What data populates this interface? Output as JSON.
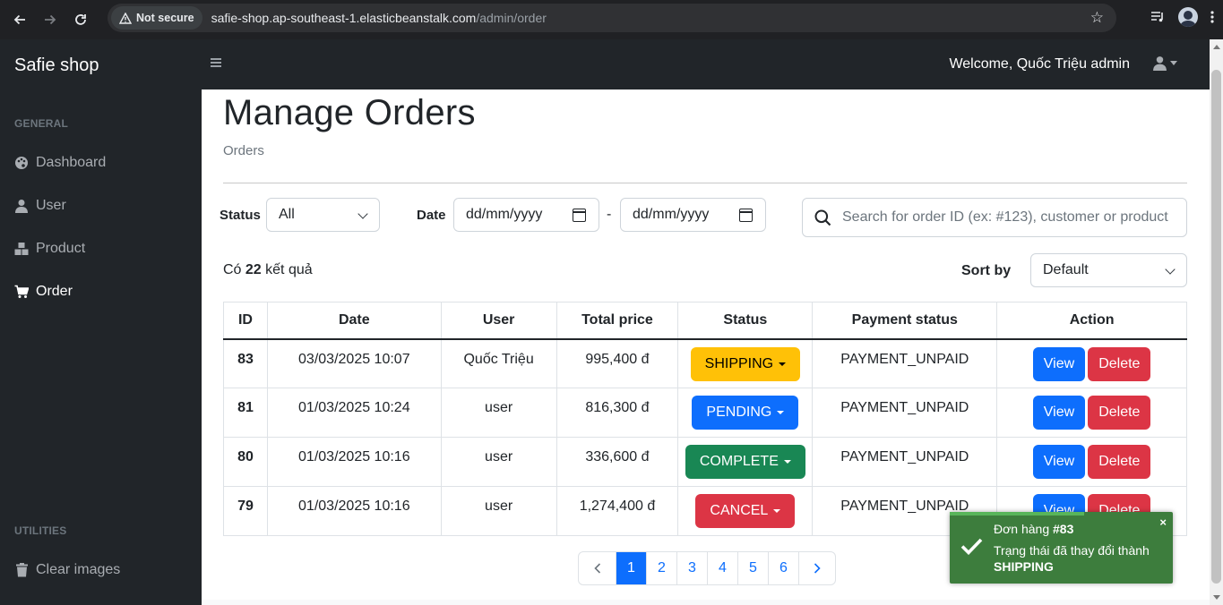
{
  "browser": {
    "security_label": "Not secure",
    "url_host": "safie-shop.ap-southeast-1.elasticbeanstalk.com",
    "url_path": "/admin/order"
  },
  "sidebar": {
    "brand": "Safie shop",
    "general_heading": "GENERAL",
    "utilities_heading": "UTILITIES",
    "items": [
      {
        "label": "Dashboard",
        "icon": "palette-icon"
      },
      {
        "label": "User",
        "icon": "user-icon"
      },
      {
        "label": "Product",
        "icon": "boxes-icon"
      },
      {
        "label": "Order",
        "icon": "cart-icon"
      }
    ],
    "utility_items": [
      {
        "label": "Clear images",
        "icon": "trash-icon"
      }
    ]
  },
  "topbar": {
    "welcome": "Welcome, Quốc Triệu admin"
  },
  "page": {
    "title": "Manage Orders",
    "breadcrumb": "Orders"
  },
  "filters": {
    "status_label": "Status",
    "status_value": "All",
    "date_label": "Date",
    "date_from": "dd/mm/yyyy",
    "date_separator": "-",
    "date_to": "dd/mm/yyyy",
    "search_placeholder": "Search for order ID (ex: #123), customer or product"
  },
  "results": {
    "prefix": "Có",
    "count": "22",
    "suffix": "kết quả",
    "sort_label": "Sort by",
    "sort_value": "Default"
  },
  "table": {
    "headers": [
      "ID",
      "Date",
      "User",
      "Total price",
      "Status",
      "Payment status",
      "Action"
    ],
    "view_label": "View",
    "delete_label": "Delete",
    "rows": [
      {
        "id": "83",
        "date": "03/03/2025 10:07",
        "user": "Quốc Triệu",
        "total": "995,400 đ",
        "status": "SHIPPING",
        "payment": "PAYMENT_UNPAID"
      },
      {
        "id": "81",
        "date": "01/03/2025 10:24",
        "user": "user",
        "total": "816,300 đ",
        "status": "PENDING",
        "payment": "PAYMENT_UNPAID"
      },
      {
        "id": "80",
        "date": "01/03/2025 10:16",
        "user": "user",
        "total": "336,600 đ",
        "status": "COMPLETE",
        "payment": "PAYMENT_UNPAID"
      },
      {
        "id": "79",
        "date": "01/03/2025 10:16",
        "user": "user",
        "total": "1,274,400 đ",
        "status": "CANCEL",
        "payment": "PAYMENT_UNPAID"
      }
    ]
  },
  "status_colors": {
    "SHIPPING": "#ffc107",
    "PENDING": "#0d6efd",
    "COMPLETE": "#198754",
    "CANCEL": "#dc3545"
  },
  "pagination": {
    "prev": "‹",
    "pages": [
      "1",
      "2",
      "3",
      "4",
      "5",
      "6"
    ],
    "active": "1",
    "next": "›"
  },
  "toast": {
    "title_prefix": "Đơn hàng",
    "order_ref": "#83",
    "message": "Trạng thái đã thay đổi thành",
    "new_status": "SHIPPING",
    "close": "×"
  }
}
